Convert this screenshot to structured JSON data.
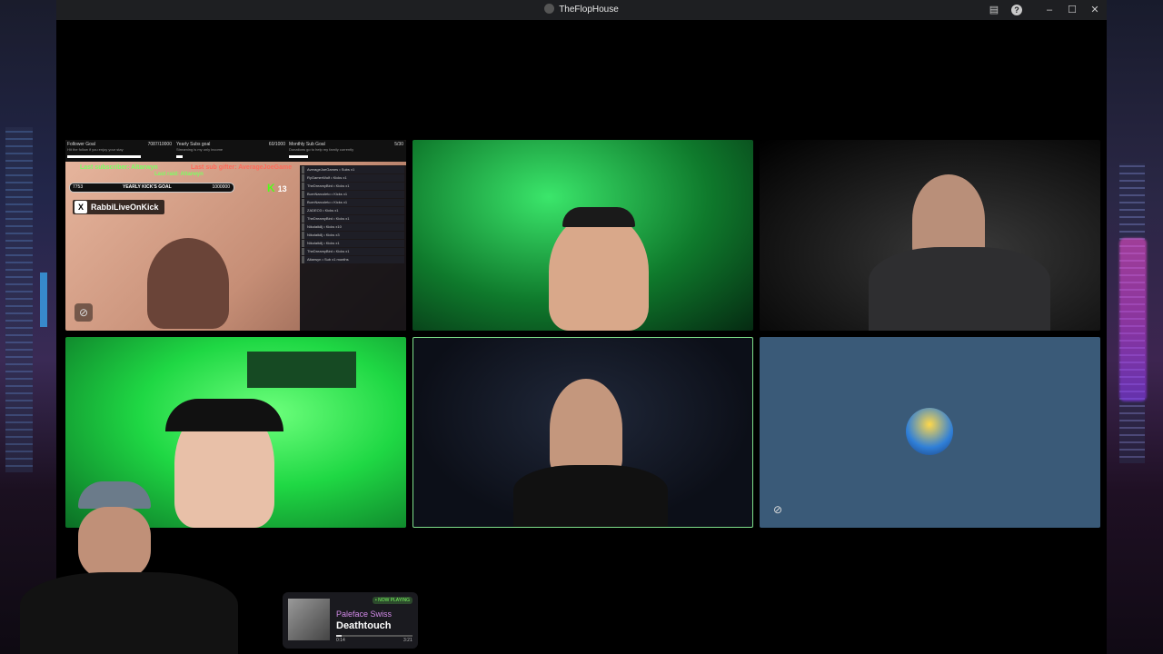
{
  "window": {
    "title": "TheFlopHouse"
  },
  "overlay": {
    "goals": [
      {
        "label": "Follower Goal",
        "value": "7087/10000",
        "desc": "Hit the follow if you enjoy your stay",
        "progress": 0.7087
      },
      {
        "label": "Yearly Subs goal",
        "value": "60/1000",
        "desc": "Streaming is my only income",
        "progress": 0.06
      },
      {
        "label": "Monthly Sub Goal",
        "value": "5/30",
        "desc": "Donations go to help my family currently",
        "progress": 0.17
      }
    ],
    "last_subscriber": "Last subscriber: Altarwyn",
    "last_sub_gifter": "Last sub gifter: AverageJoeGame",
    "last_raid": "Last raid: Altarwyn",
    "kick_goal": {
      "current": "7753",
      "label": "YEARLY KICK'S GOAL",
      "target": "1000000"
    },
    "kick_count": "13",
    "handle": "RabbiLiveOnKick",
    "feed": [
      "AverageJoeGames • Subs x1",
      "RyGamerWolf • Kicks x1",
      "TheDreamyBird • Kicks x1",
      "BurnNarcoleto • Kicks x1",
      "BurnNarcoleto • Kicks x1",
      "ZADEO3 • Kicks x1",
      "TheDreamyBird • Kicks x1",
      "Nikolaik8j • Kicks x10",
      "Nikolaik8j • Kicks x3",
      "Nikolaik8j • Kicks x1",
      "TheDreamyBird • Kicks x1",
      "Altarwyn • Sub x1 months"
    ]
  },
  "now_playing": {
    "badge": "• NOW PLAYING",
    "artist": "Paleface Swiss",
    "track": "Deathtouch",
    "elapsed": "0:14",
    "duration": "3:21",
    "progress": 0.07
  }
}
